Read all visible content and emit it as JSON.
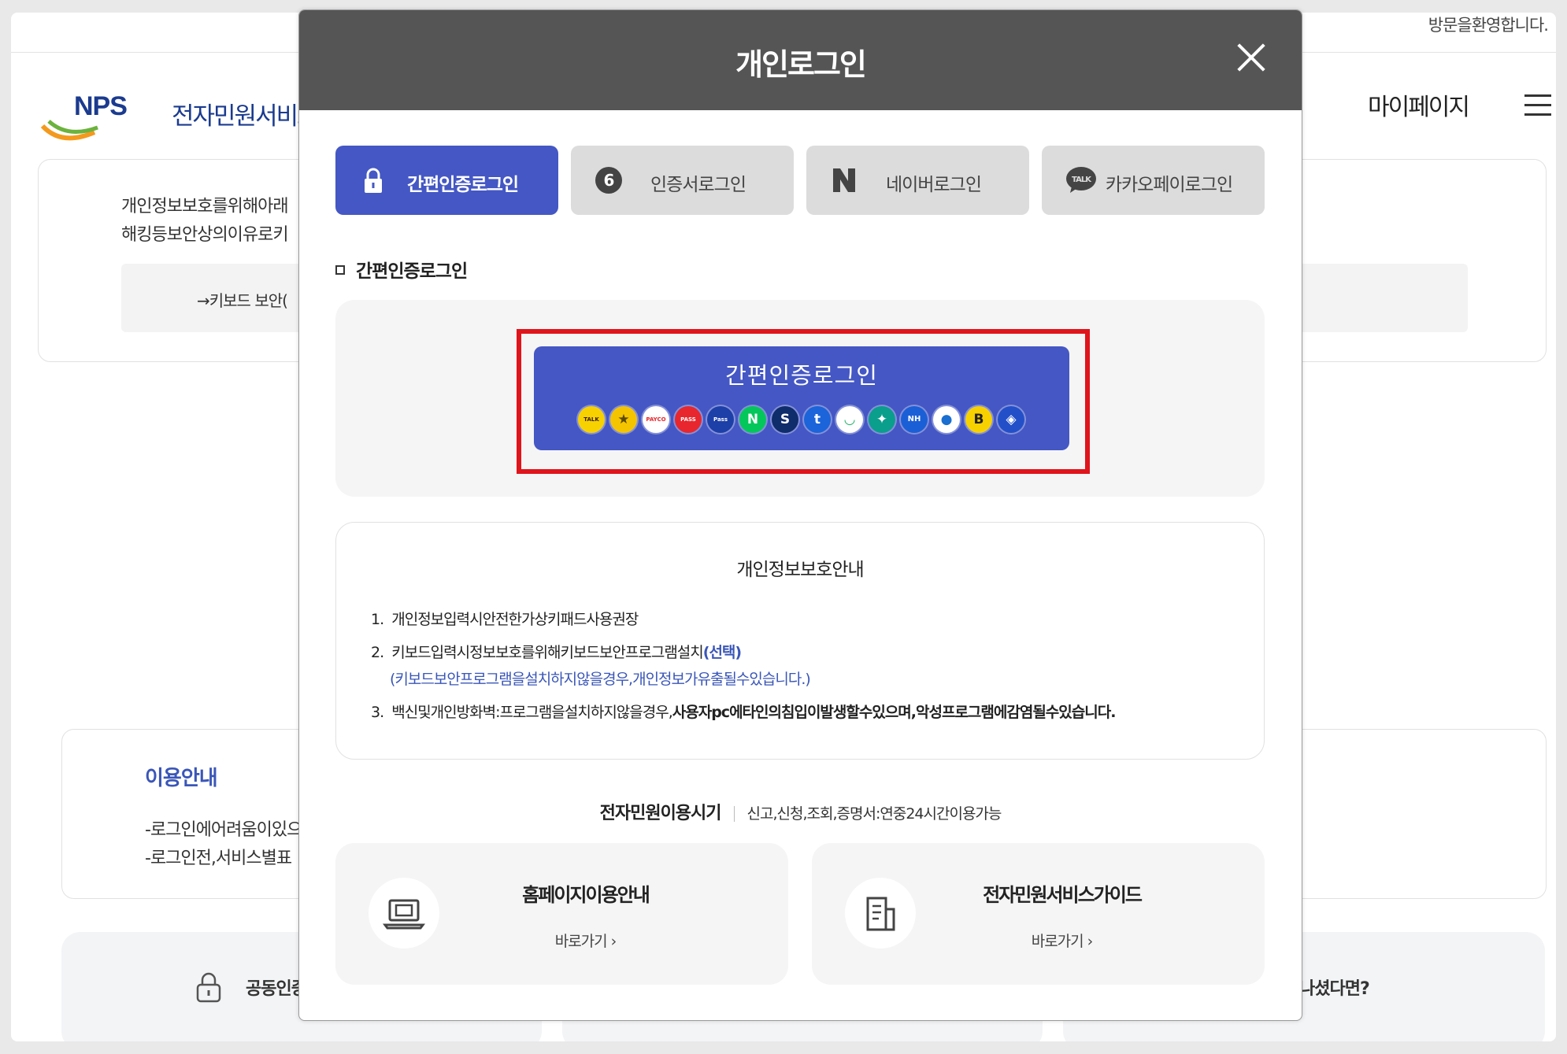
{
  "page": {
    "welcome_text": "방문을환영합니다.",
    "logo_text": "NPS",
    "site_name": "전자민원서비스",
    "mypage_label": "마이페이지",
    "background": {
      "privacy_line1": "개인정보보호를위해아래",
      "privacy_line2": "해킹등보안상의이유로키",
      "keyboard_security": "→키보드 보안(",
      "usage_title": "이용안내",
      "usage_line1": "-로그인에어려움이있으",
      "usage_line2": "-로그인전,서비스별표",
      "cert_card_label": "공동인증",
      "question_fragment": "나셨다면?"
    }
  },
  "modal": {
    "title": "개인로그인",
    "tabs": [
      {
        "label": "간편인증로그인",
        "icon": "lock-icon",
        "active": true
      },
      {
        "label": "인증서로그인",
        "icon": "certificate-icon",
        "active": false
      },
      {
        "label": "네이버로그인",
        "icon": "naver-icon",
        "active": false
      },
      {
        "label": "카카오페이로그인",
        "icon": "kakao-talk-icon",
        "active": false
      }
    ],
    "section_label": "간편인증로그인",
    "simple_login_button": "간편인증로그인",
    "cert_provider_icons": [
      {
        "name": "kakao-talk-icon",
        "text": "TALK",
        "bg": "#f7d100",
        "fg": "#3b1e1e"
      },
      {
        "name": "kb-star-icon",
        "text": "★",
        "bg": "#f5c400",
        "fg": "#5a4a00"
      },
      {
        "name": "payco-icon",
        "text": "PAYCO",
        "bg": "#ffffff",
        "fg": "#e8262d"
      },
      {
        "name": "pass-icon",
        "text": "PASS",
        "bg": "#e8262d",
        "fg": "#ffffff"
      },
      {
        "name": "samsung-pass-icon",
        "text": "Pass",
        "bg": "#1d3fa8",
        "fg": "#ffffff"
      },
      {
        "name": "naver-icon",
        "text": "N",
        "bg": "#03c75a",
        "fg": "#ffffff"
      },
      {
        "name": "shinhan-icon",
        "text": "S",
        "bg": "#0f2c6b",
        "fg": "#ffffff"
      },
      {
        "name": "toss-icon",
        "text": "t",
        "bg": "#1b64da",
        "fg": "#ffffff"
      },
      {
        "name": "banksalad-icon",
        "text": "◡",
        "bg": "#ffffff",
        "fg": "#20b26b"
      },
      {
        "name": "hana-icon",
        "text": "✦",
        "bg": "#0a9e8c",
        "fg": "#ffffff"
      },
      {
        "name": "nh-icon",
        "text": "NH",
        "bg": "#1b5fd6",
        "fg": "#ffffff"
      },
      {
        "name": "woori-icon",
        "text": "●",
        "bg": "#ffffff",
        "fg": "#1a6fd1"
      },
      {
        "name": "kbank-icon",
        "text": "B",
        "bg": "#f7d100",
        "fg": "#222222"
      },
      {
        "name": "gov-shield-icon",
        "text": "◈",
        "bg": "#2350c9",
        "fg": "#ffffff"
      }
    ],
    "privacy_notice": {
      "title": "개인정보보호안내",
      "item1_num": "1.",
      "item1": "개인정보입력시안전한가상키패드사용권장",
      "item2_num": "2.",
      "item2": "키보드입력시정보보호를위해키보드보안프로그램설치",
      "item2_optional": "(선택)",
      "item2_sub": "(키보드보안프로그램을설치하지않을경우,개인정보가유출될수있습니다.)",
      "item3_num": "3.",
      "item3_normal": "백신및개인방화벽:프로그램을설치하지않을경우,",
      "item3_bold": "사용자pc에타인의침입이발생할수있으며,악성프로그램에감염될수있습니다."
    },
    "hours": {
      "label": "전자민원이용시기",
      "text": "신고,신청,조회,증명서:연중24시간이용가능"
    },
    "guides": [
      {
        "title": "홈페이지이용안내",
        "link": "바로가기 ›",
        "icon": "laptop-icon"
      },
      {
        "title": "전자민원서비스가이드",
        "link": "바로가기 ›",
        "icon": "document-icon"
      }
    ]
  }
}
